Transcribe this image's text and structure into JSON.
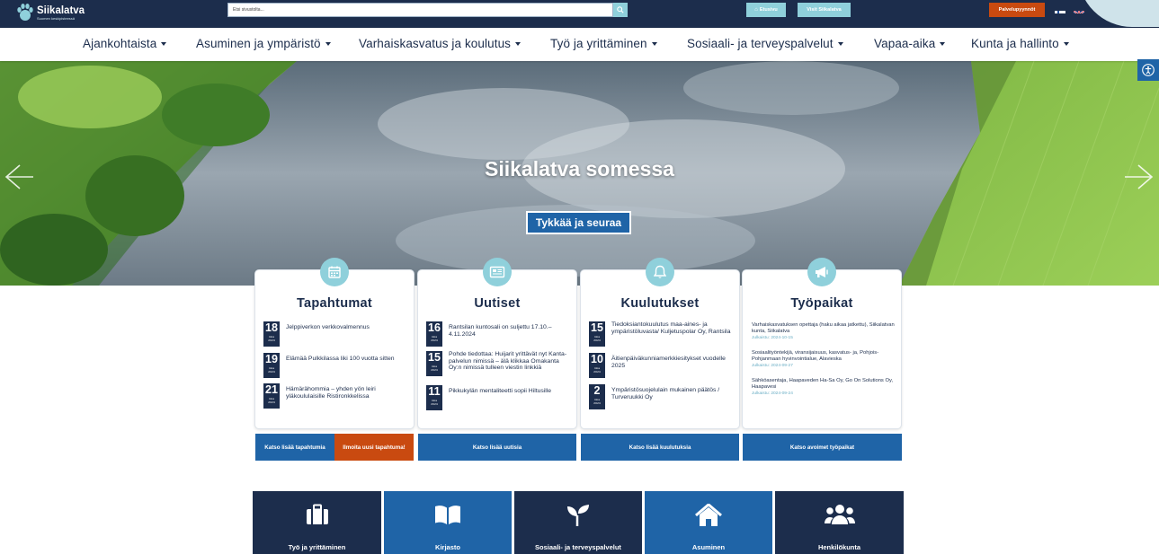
{
  "header": {
    "logo_name": "Siikalatva",
    "logo_tagline": "Suomen keskipisteessä",
    "search_placeholder": "Etsi sivustolta...",
    "home_label": "Etusivu",
    "visit_label": "Visit Siikalatva",
    "service_label": "Palvelupyynnöt"
  },
  "nav": [
    "Ajankohtaista",
    "Asuminen ja ympäristö",
    "Varhaiskasvatus ja koulutus",
    "Työ ja yrittäminen",
    "Sosiaali- ja terveyspalvelut",
    "Vapaa-aika",
    "Kunta ja hallinto"
  ],
  "hero": {
    "title": "Siikalatva somessa",
    "button": "Tykkää ja seuraa"
  },
  "cards": [
    {
      "title": "Tapahtumat",
      "icon": "calendar-icon",
      "items": [
        {
          "day": "18",
          "month": "loka",
          "year": "2024",
          "text": "Jelppiverkon verkkovalmennus"
        },
        {
          "day": "19",
          "month": "loka",
          "year": "2024",
          "text": "Elämää Pulkkilassa liki 100 vuotta sitten"
        },
        {
          "day": "21",
          "month": "loka",
          "year": "2024",
          "text": "Hämärähommia – yhden yön leiri yläkoululaisille Ristironkkelissa"
        }
      ]
    },
    {
      "title": "Uutiset",
      "icon": "newspaper-icon",
      "items": [
        {
          "day": "16",
          "month": "loka",
          "year": "2024",
          "text": "Rantsilan kuntosali on suljettu 17.10.–4.11.2024"
        },
        {
          "day": "15",
          "month": "loka",
          "year": "2024",
          "text": "Pohde tiedottaa: Huijarit yrittävät nyt Kanta-palvelun nimissä – älä klikkaa Omakanta Oy:n nimissä tulleen viestin linkkiä"
        },
        {
          "day": "11",
          "month": "loka",
          "year": "2024",
          "text": "Pikkukylän mentaliteetti sopii Hiltusille"
        }
      ]
    },
    {
      "title": "Kuulutukset",
      "icon": "bell-icon",
      "items": [
        {
          "day": "15",
          "month": "loka",
          "year": "2024",
          "text": "Tiedoksiantokuulutus maa-aines- ja ympäristöluvasta/ Kuljetuspolar Oy, Rantsila"
        },
        {
          "day": "10",
          "month": "loka",
          "year": "2024",
          "text": "Äitienpäiväkunniamerkkiesitykset vuodelle 2025"
        },
        {
          "day": "2",
          "month": "loka",
          "year": "2024",
          "text": "Ympäristösuojelulain mukainen päätös / Turveruukki Oy"
        }
      ]
    },
    {
      "title": "Työpaikat",
      "icon": "megaphone-icon",
      "jobs": [
        {
          "text": "Varhaiskasvatuksen opettaja (haku aikaa jatkettu), Siikalatvan kunta, Siikalatva",
          "date": "Julkaistu: 2024-10-15"
        },
        {
          "text": "Sosiaalityöntekijä, viransijaisuus, kasvatus- ja, Pohjois-Pohjanmaan hyvinvointialue, Alavieska",
          "date": "Julkaistu: 2024-09-27"
        },
        {
          "text": "Sähköasentaja, Haapaveden Ha-Sa Oy, Go On Solutions Oy, Haapavesi",
          "date": "Julkaistu: 2024-09-24"
        }
      ]
    }
  ],
  "card_buttons": {
    "events_more": "Katso lisää tapahtumia",
    "events_report": "Ilmoita uusi tapahtuma!",
    "news_more": "Katso lisää uutisia",
    "notices_more": "Katso lisää kuulutuksia",
    "jobs_more": "Katso avoimet työpaikat"
  },
  "tiles": [
    {
      "label": "Työ ja yrittäminen",
      "icon": "briefcase-icon",
      "color": "#1c2d4c"
    },
    {
      "label": "Kirjasto",
      "icon": "book-icon",
      "color": "#1f64a7"
    },
    {
      "label": "Sosiaali- ja terveyspalvelut",
      "icon": "sprout-icon",
      "color": "#1c2d4c"
    },
    {
      "label": "Asuminen",
      "icon": "house-icon",
      "color": "#1f64a7"
    },
    {
      "label": "Henkilökunta",
      "icon": "people-icon",
      "color": "#1c2d4c"
    }
  ],
  "colors": {
    "navy": "#1c2d4c",
    "blue": "#1f64a7",
    "teal": "#8fd0db",
    "orange": "#c94a10"
  }
}
